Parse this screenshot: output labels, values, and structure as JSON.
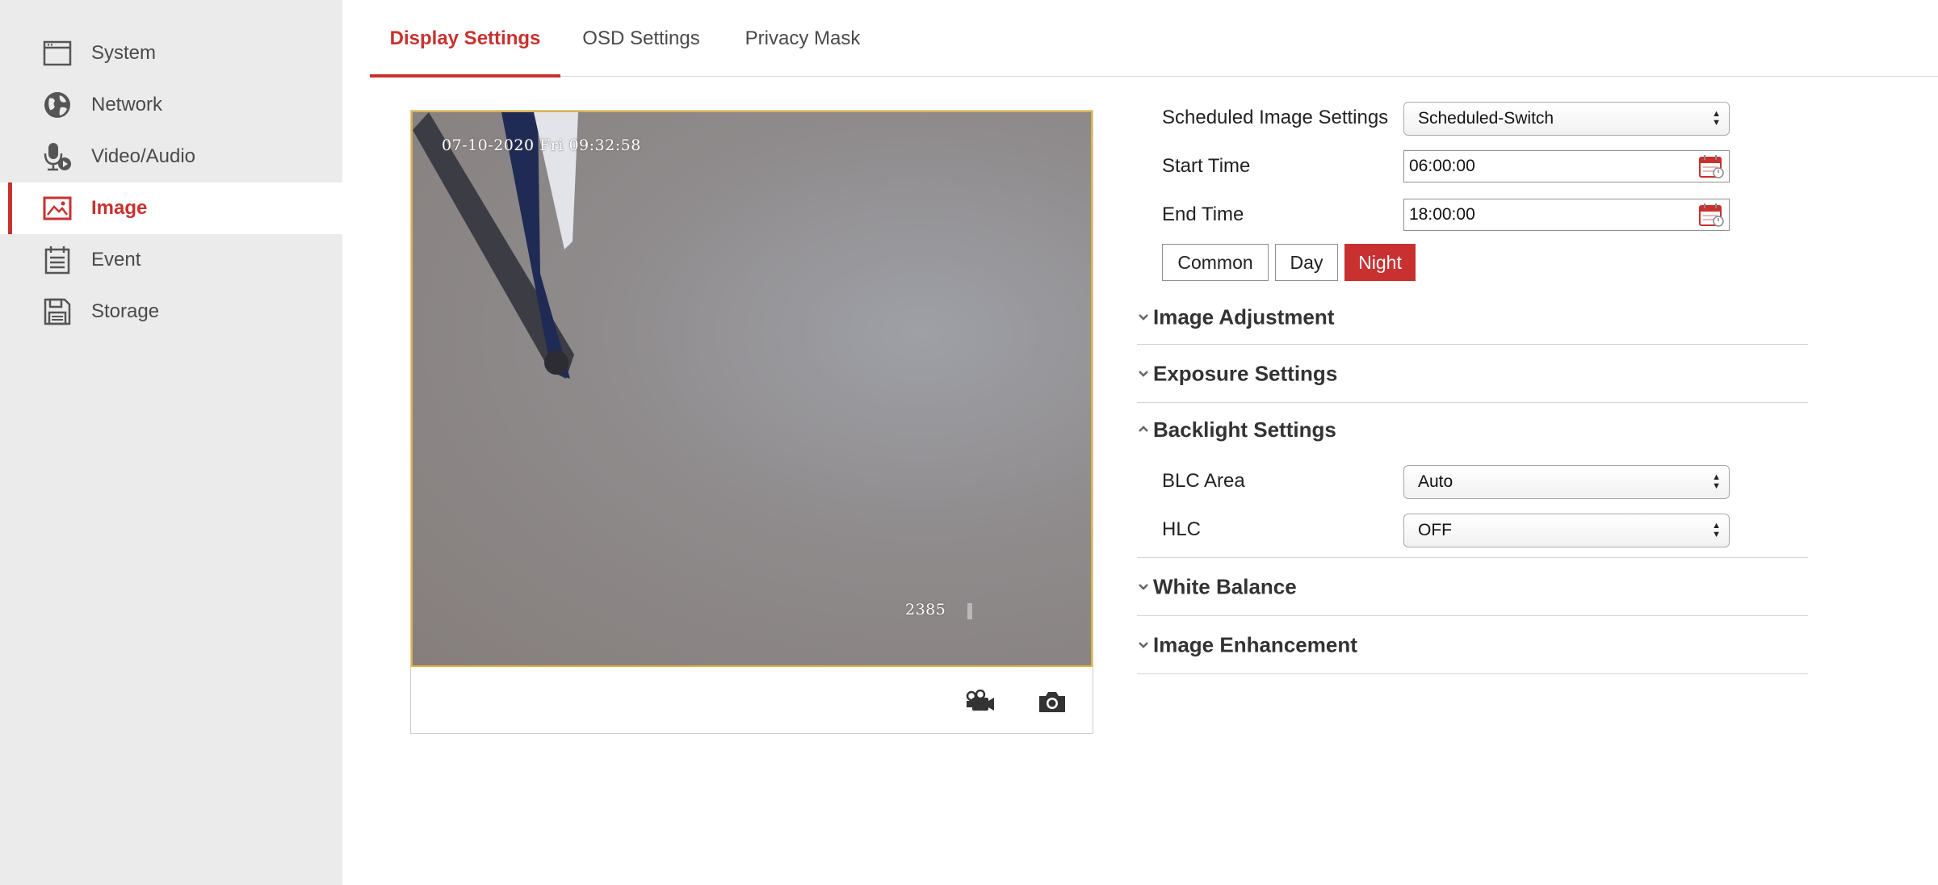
{
  "sidebar": {
    "items": [
      {
        "label": "System",
        "icon": "window-icon"
      },
      {
        "label": "Network",
        "icon": "globe-icon"
      },
      {
        "label": "Video/Audio",
        "icon": "microphone-icon"
      },
      {
        "label": "Image",
        "icon": "image-icon",
        "active": true
      },
      {
        "label": "Event",
        "icon": "calendar-icon"
      },
      {
        "label": "Storage",
        "icon": "floppy-disk-icon"
      }
    ]
  },
  "tabs": [
    {
      "label": "Display Settings",
      "active": true
    },
    {
      "label": "OSD Settings"
    },
    {
      "label": "Privacy Mask"
    }
  ],
  "preview": {
    "timestamp": "07-10-2020 Fri 09:32:58",
    "overlay_number": "2385",
    "tools": [
      "record-icon",
      "camera-icon"
    ]
  },
  "settings": {
    "scheduled": {
      "label": "Scheduled Image Settings",
      "value": "Scheduled-Switch"
    },
    "start_time": {
      "label": "Start Time",
      "value": "06:00:00"
    },
    "end_time": {
      "label": "End Time",
      "value": "18:00:00"
    },
    "modes": [
      {
        "label": "Common"
      },
      {
        "label": "Day"
      },
      {
        "label": "Night",
        "active": true
      }
    ]
  },
  "sections": {
    "image_adjustment": "Image Adjustment",
    "exposure": "Exposure Settings",
    "backlight": "Backlight Settings",
    "white_balance": "White Balance",
    "image_enhancement": "Image Enhancement"
  },
  "backlight": {
    "blc_area": {
      "label": "BLC Area",
      "value": "Auto"
    },
    "hlc": {
      "label": "HLC",
      "value": "OFF"
    }
  },
  "colors": {
    "accent": "#c8312f",
    "sidebar_bg": "#ebebeb",
    "video_border": "#e2b33c"
  }
}
